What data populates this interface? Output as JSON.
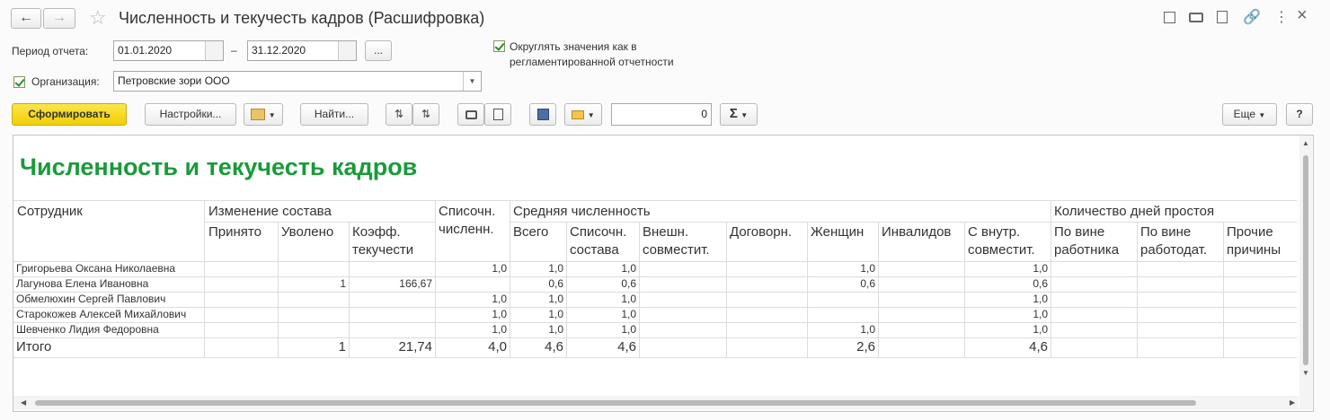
{
  "window": {
    "title": "Численность и текучесть кадров (Расшифровка)"
  },
  "filters": {
    "period_label": "Период отчета:",
    "date_from": "01.01.2020",
    "date_separator": "–",
    "date_to": "31.12.2020",
    "more_label": "...",
    "round_label": "Округлять значения как в регламентированной отчетности",
    "org_label": "Организация:",
    "org_value": "Петровские зори ООО"
  },
  "toolbar": {
    "generate": "Сформировать",
    "settings": "Настройки...",
    "find": "Найти...",
    "sum_value": "0",
    "more": "Еще",
    "help": "?"
  },
  "report": {
    "title": "Численность и текучесть кадров",
    "headers": {
      "employee": "Сотрудник",
      "composition": "Изменение состава",
      "hired": "Принято",
      "dismissed": "Уволено",
      "turnover": "Коэфф. текучести",
      "listed": "Списочн. численн.",
      "average": "Средняя численность",
      "total": "Всего",
      "listed_comp": "Списочн. состава",
      "external": "Внешн. совместит.",
      "contract": "Договорн.",
      "women": "Женщин",
      "disabled": "Инвалидов",
      "internal": "С внутр. совместит.",
      "downtime": "Количество дней простоя",
      "worker_fault": "По вине работника",
      "employer_fault": "По вине работодат.",
      "other": "Прочие причины"
    },
    "rows": [
      {
        "name": "Григорьева Оксана Николаевна",
        "hired": "",
        "dismissed": "",
        "turnover": "",
        "listed": "1,0",
        "total": "1,0",
        "listed_comp": "1,0",
        "external": "",
        "contract": "",
        "women": "1,0",
        "disabled": "",
        "internal": "1,0"
      },
      {
        "name": "Лагунова Елена Ивановна",
        "hired": "",
        "dismissed": "1",
        "turnover": "166,67",
        "listed": "",
        "total": "0,6",
        "listed_comp": "0,6",
        "external": "",
        "contract": "",
        "women": "0,6",
        "disabled": "",
        "internal": "0,6"
      },
      {
        "name": "Обмелюхин Сергей Павлович",
        "hired": "",
        "dismissed": "",
        "turnover": "",
        "listed": "1,0",
        "total": "1,0",
        "listed_comp": "1,0",
        "external": "",
        "contract": "",
        "women": "",
        "disabled": "",
        "internal": "1,0"
      },
      {
        "name": "Старокожев Алексей Михайлович",
        "hired": "",
        "dismissed": "",
        "turnover": "",
        "listed": "1,0",
        "total": "1,0",
        "listed_comp": "1,0",
        "external": "",
        "contract": "",
        "women": "",
        "disabled": "",
        "internal": "1,0"
      },
      {
        "name": "Шевченко Лидия Федоровна",
        "hired": "",
        "dismissed": "",
        "turnover": "",
        "listed": "1,0",
        "total": "1,0",
        "listed_comp": "1,0",
        "external": "",
        "contract": "",
        "women": "1,0",
        "disabled": "",
        "internal": "1,0"
      }
    ],
    "totals": {
      "name": "Итого",
      "dismissed": "1",
      "turnover": "21,74",
      "listed": "4,0",
      "total": "4,6",
      "listed_comp": "4,6",
      "women": "2,6",
      "internal": "4,6"
    }
  },
  "colors": {
    "accent_yellow": "#f5d90a",
    "title_green": "#1a9a3a"
  }
}
